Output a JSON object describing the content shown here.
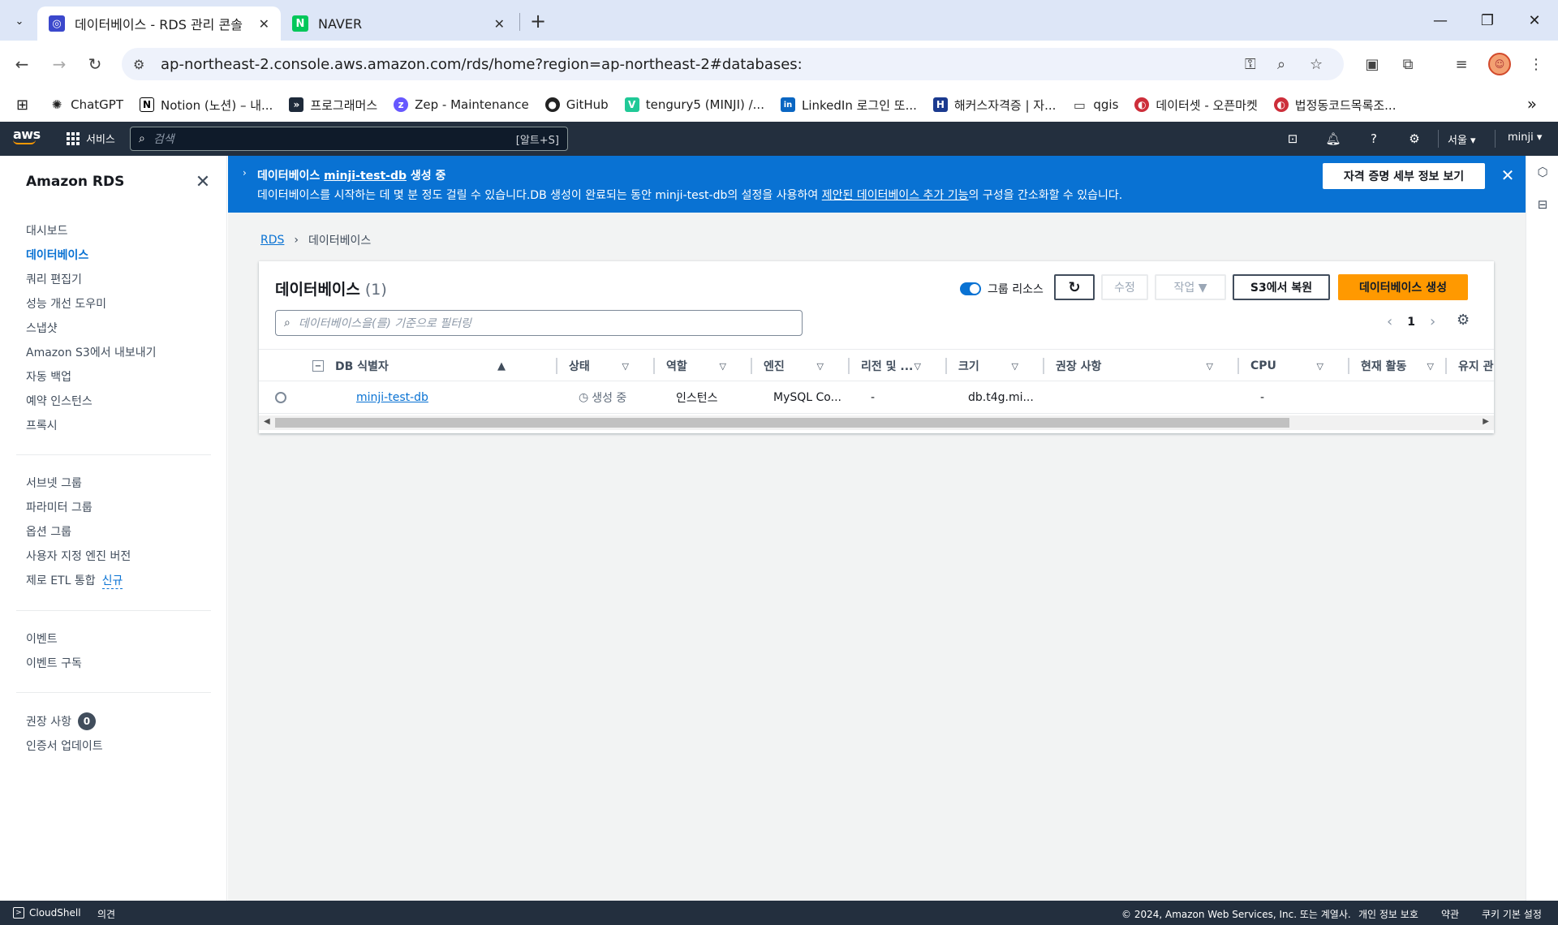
{
  "browser": {
    "tabs": [
      {
        "title": "데이터베이스 - RDS 관리 콘솔",
        "close": "✕"
      },
      {
        "title": "NAVER",
        "favicon": "N",
        "close": "✕"
      }
    ],
    "new_tab": "+",
    "url": "ap-northeast-2.console.aws.amazon.com/rds/home?region=ap-northeast-2#databases:",
    "bookmarks": [
      {
        "label": "ChatGPT"
      },
      {
        "label": "Notion (노션) – 내..."
      },
      {
        "label": "프로그래머스"
      },
      {
        "label": "Zep - Maintenance"
      },
      {
        "label": "GitHub"
      },
      {
        "label": "tengury5 (MINJI) /..."
      },
      {
        "label": "LinkedIn 로그인 또..."
      },
      {
        "label": "해커스자격증 | 자..."
      },
      {
        "label": "qgis"
      },
      {
        "label": "데이터셋 - 오픈마켓"
      },
      {
        "label": "법정동코드목록조..."
      }
    ],
    "bookmark_icons": {
      "notion": "N",
      "linkedin": "in",
      "hackers": "H",
      "tengury": "V"
    }
  },
  "aws": {
    "logo": "aws",
    "services": "서비스",
    "search_placeholder": "검색",
    "search_shortcut": "[알트+S]",
    "region": "서울 ▾",
    "user": "minji ▾"
  },
  "sidebar": {
    "title": "Amazon RDS",
    "group1": [
      "대시보드",
      "데이터베이스",
      "쿼리 편집기",
      "성능 개선 도우미",
      "스냅샷",
      "Amazon S3에서 내보내기",
      "자동 백업",
      "예약 인스턴스",
      "프록시"
    ],
    "group2": [
      "서브넷 그룹",
      "파라미터 그룹",
      "옵션 그룹",
      "사용자 지정 엔진 버전"
    ],
    "zero_etl": "제로 ETL 통합",
    "new_label": "신규",
    "group3": [
      "이벤트",
      "이벤트 구독"
    ],
    "recommendations": "권장 사항",
    "recommendations_count": "0",
    "cert_update": "인증서 업데이트"
  },
  "flash": {
    "title_prefix": "데이터베이스 ",
    "db_name": "minji-test-db",
    "title_suffix": " 생성 중",
    "message_part1": "데이터베이스를 시작하는 데 몇 분 정도 걸릴 수 있습니다.DB 생성이 완료되는 동안 minji-test-db의 설정을 사용하여 ",
    "message_link": "제안된 데이터베이스 추가 기능",
    "message_part2": "의 구성을 간소화할 수 있습니다.",
    "button": "자격 증명 세부 정보 보기"
  },
  "breadcrumb": {
    "root": "RDS",
    "current": "데이터베이스"
  },
  "panel": {
    "title": "데이터베이스",
    "count": "(1)",
    "group_toggle": "그룹 리소스",
    "modify": "수정",
    "actions": "작업 ▼",
    "restore_s3": "S3에서 복원",
    "create": "데이터베이스 생성",
    "filter_placeholder": "데이터베이스을(를) 기준으로 필터링",
    "page": "1"
  },
  "table": {
    "columns": [
      "DB 식별자",
      "상태",
      "역할",
      "엔진",
      "리전 및 ...",
      "크기",
      "권장 사항",
      "CPU",
      "현재 활동",
      "유지 관리"
    ],
    "rows": [
      {
        "id": "minji-test-db",
        "status": "생성 중",
        "role": "인스턴스",
        "engine": "MySQL Co...",
        "region": "-",
        "size": "db.t4g.mi...",
        "recommendations": "",
        "cpu": "-",
        "activity": "",
        "maintenance": ""
      }
    ]
  },
  "footer": {
    "cloudshell": "CloudShell",
    "feedback": "의견",
    "copyright": "© 2024, Amazon Web Services, Inc. 또는 계열사.",
    "privacy": "개인 정보 보호",
    "terms": "약관",
    "cookies": "쿠키 기본 설정"
  }
}
